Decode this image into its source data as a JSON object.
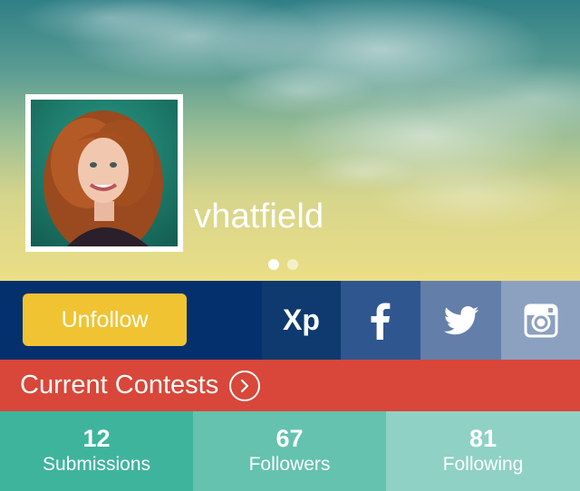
{
  "profile": {
    "username": "vhatfield",
    "carousel": {
      "pages": 2,
      "active_index": 0
    }
  },
  "actions": {
    "unfollow_label": "Unfollow",
    "xp_label": "Xp",
    "facebook_icon": "facebook-icon",
    "twitter_icon": "twitter-icon",
    "instagram_icon": "instagram-icon"
  },
  "contests": {
    "label": "Current Contests",
    "icon": "chevron-right-circle-icon"
  },
  "stats": [
    {
      "value": "12",
      "label": "Submissions"
    },
    {
      "value": "67",
      "label": "Followers"
    },
    {
      "value": "81",
      "label": "Following"
    }
  ],
  "colors": {
    "action_bar": "#05306e",
    "unfollow_button": "#f0c332",
    "xp": "#0e3a6f",
    "facebook": "#2f568f",
    "twitter": "#637fa9",
    "instagram": "#8ca1c0",
    "contests_bar": "#d84739",
    "stat_submissions": "#3fb49c",
    "stat_followers": "#64c2af",
    "stat_following": "#8fd1c5"
  }
}
